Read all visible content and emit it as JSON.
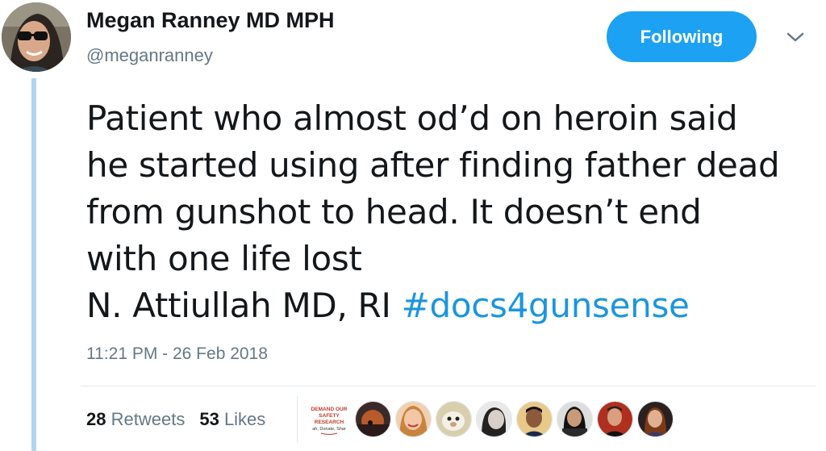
{
  "author": {
    "name": "Megan Ranney MD MPH",
    "handle": "@meganranney"
  },
  "follow_button": {
    "label": "Following"
  },
  "tweet": {
    "lines": [
      "Patient who almost od’d on heroin said",
      "he started using after finding father dead",
      "from gunshot to head. It doesn’t end",
      "with one life lost",
      "N. Attiullah MD, RI "
    ],
    "hashtag": "#docs4gunsense"
  },
  "timestamp": "11:21 PM - 26 Feb 2018",
  "stats": {
    "retweets_count": "28",
    "retweets_label": "Retweets",
    "likes_count": "53",
    "likes_label": "Likes"
  },
  "likers": {
    "poster_text": [
      "DEMAND OUR",
      "SAFETY",
      "RESEARCH",
      "ah, Donate, Shar"
    ],
    "count": 9
  },
  "colors": {
    "accent": "#1da1f2",
    "hashtag": "#1b95e0",
    "secondary_text": "#657786",
    "thread_line": "#b0d4f1"
  }
}
